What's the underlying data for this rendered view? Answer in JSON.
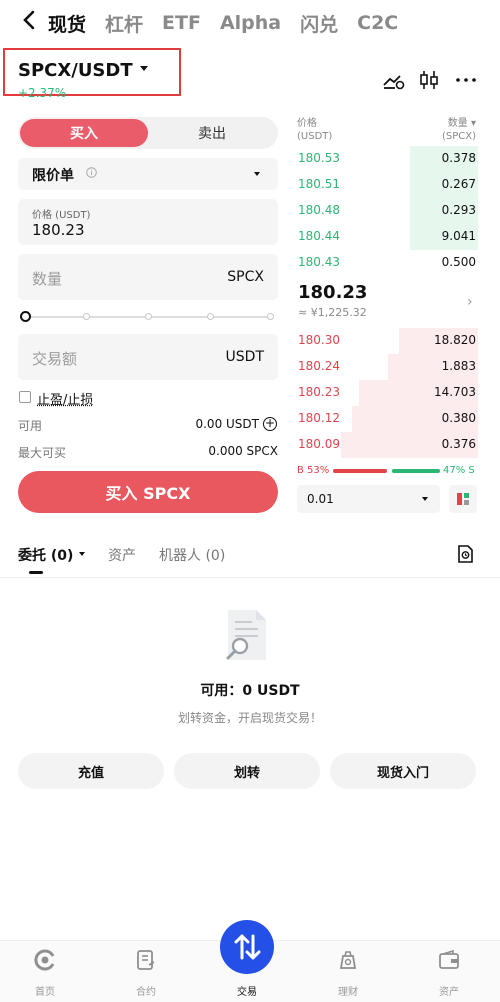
{
  "topnav": {
    "tabs": [
      "现货",
      "杠杆",
      "ETF",
      "Alpha",
      "闪兑",
      "C2C"
    ]
  },
  "pair": {
    "name": "SPCX/USDT",
    "change": "+2.37%"
  },
  "order_panel": {
    "buy_label": "买入",
    "sell_label": "卖出",
    "order_type": "限价单",
    "price_caption": "价格 (USDT)",
    "price_value": "180.23",
    "quantity_placeholder": "数量",
    "quantity_unit": "SPCX",
    "total_placeholder": "交易额",
    "total_unit": "USDT",
    "tpsl_label": "止盈/止损",
    "available_label": "可用",
    "available_value": "0.00 USDT",
    "max_buy_label": "最大可买",
    "max_buy_value": "0.000 SPCX",
    "submit_label": "买入 SPCX"
  },
  "orderbook": {
    "price_header": "价格",
    "price_unit": "(USDT)",
    "qty_header": "数量",
    "qty_unit": "(SPCX)",
    "asks": [
      {
        "price": "180.53",
        "qty": "0.378",
        "depth": 0.38
      },
      {
        "price": "180.51",
        "qty": "0.267",
        "depth": 0.38
      },
      {
        "price": "180.48",
        "qty": "0.293",
        "depth": 0.38
      },
      {
        "price": "180.44",
        "qty": "9.041",
        "depth": 0.38
      },
      {
        "price": "180.43",
        "qty": "0.500",
        "depth": 0.0
      }
    ],
    "last_price": "180.23",
    "last_fiat": "≈ ¥1,225.32",
    "bids": [
      {
        "price": "180.30",
        "qty": "18.820",
        "depth": 0.44
      },
      {
        "price": "180.24",
        "qty": "1.883",
        "depth": 0.5
      },
      {
        "price": "180.23",
        "qty": "14.703",
        "depth": 0.66
      },
      {
        "price": "180.12",
        "qty": "0.380",
        "depth": 0.7
      },
      {
        "price": "180.09",
        "qty": "0.376",
        "depth": 0.76
      }
    ],
    "buy_ratio": "B 53%",
    "sell_ratio": "47% S",
    "precision": "0.01"
  },
  "orders": {
    "tabs": [
      "委托 (0)",
      "资产",
      "机器人 (0)"
    ],
    "empty_title": "可用：0 USDT",
    "empty_subtitle": "划转资金，开启现货交易！",
    "actions": [
      "充值",
      "划转",
      "现货入门"
    ]
  },
  "bottom_nav": {
    "items": [
      "首页",
      "合约",
      "交易",
      "理财",
      "资产"
    ],
    "active": "交易"
  },
  "colors": {
    "buy": "#ea5c6a",
    "ask_green": "#2bb673",
    "bid_red": "#e2434b",
    "fab_blue": "#2450e8"
  }
}
